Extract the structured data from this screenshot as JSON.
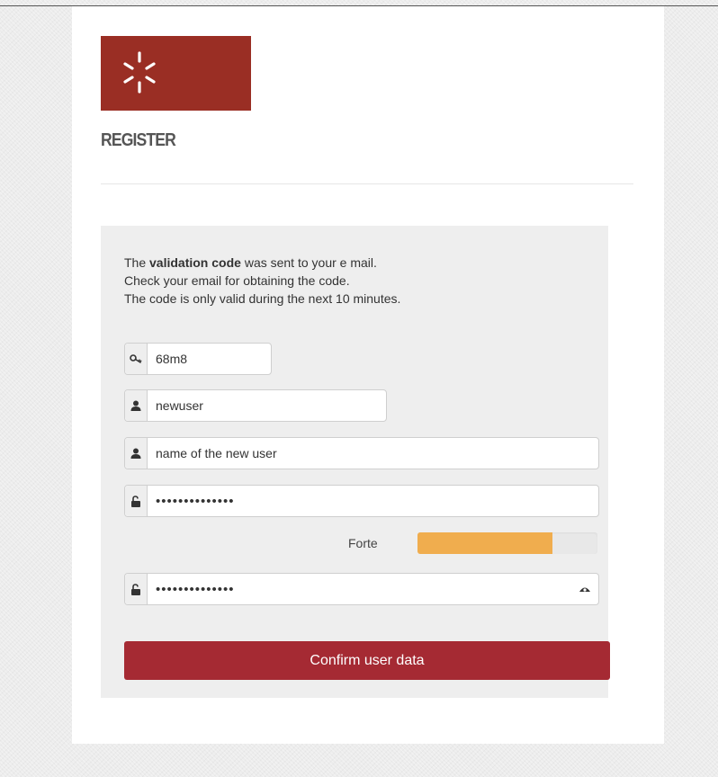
{
  "header": {
    "title": "REGISTER"
  },
  "intro": {
    "line1_prefix": "The ",
    "line1_bold": "validation code",
    "line1_suffix": " was sent to your e mail.",
    "line2": "Check your email for obtaining the code.",
    "line3": "The code is only valid during the next 10 minutes."
  },
  "form": {
    "code": {
      "value": "68m8",
      "icon": "key-icon"
    },
    "username": {
      "value": "newuser",
      "icon": "user-icon"
    },
    "fullname": {
      "value": "name of the new user",
      "icon": "user-icon"
    },
    "password": {
      "value": "aaaaaaaaaaaaaa",
      "icon": "unlock-icon"
    },
    "password_strength": {
      "label": "Forte",
      "level": 0.75,
      "color": "#f0ad4e"
    },
    "confirm_password": {
      "value": "aaaaaaaaaaaaaa",
      "icon": "unlock-icon",
      "toggle_icon": "eye-icon"
    },
    "submit_label": "Confirm user data"
  },
  "colors": {
    "brand": "#9a2e24",
    "button": "#a52a33"
  }
}
